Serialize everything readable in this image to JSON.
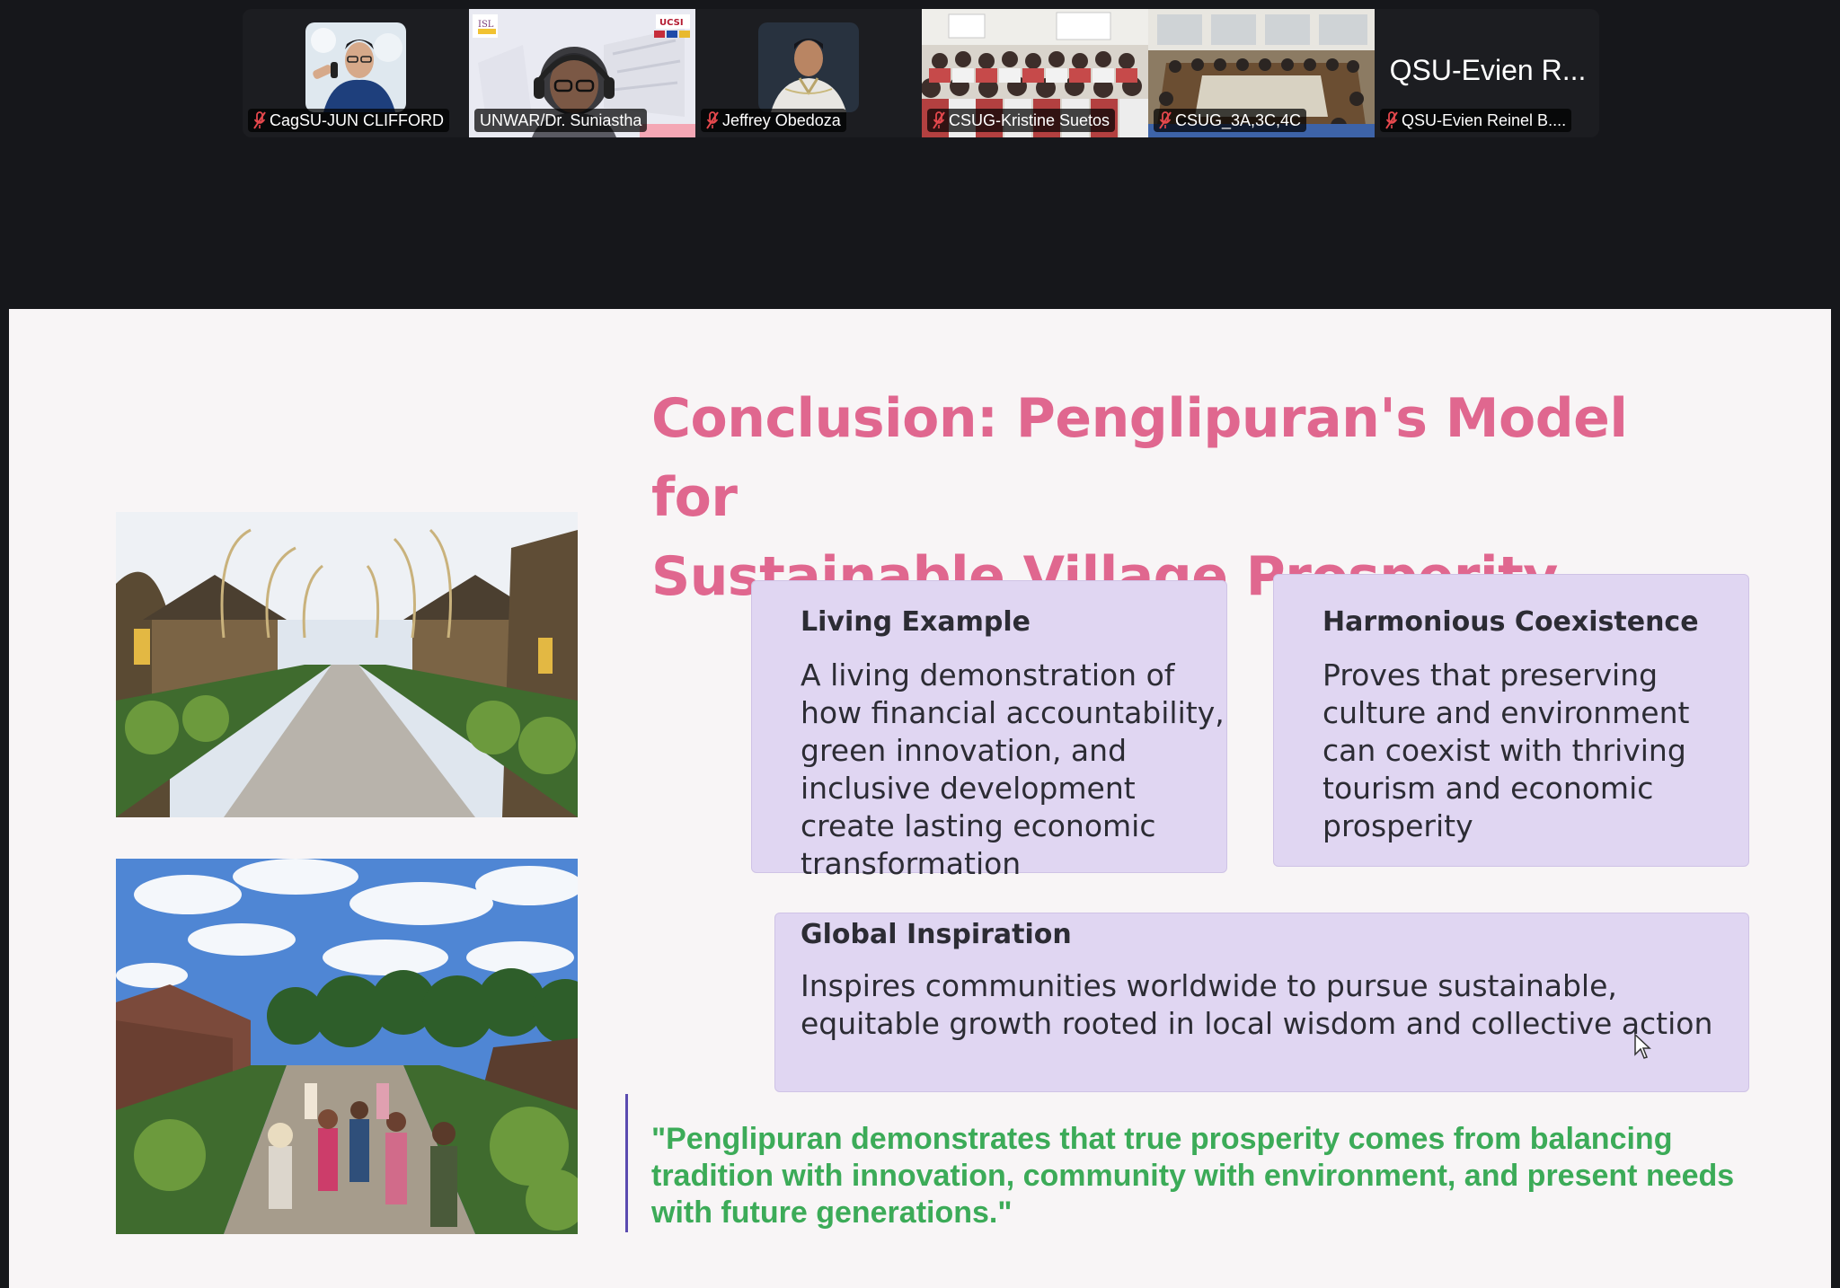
{
  "participants": [
    {
      "name": "CagSU-JUN CLIFFORD",
      "muted": true
    },
    {
      "name": "UNWAR/Dr. Suniastha",
      "muted": false,
      "active_speaker": true
    },
    {
      "name": "Jeffrey Obedoza",
      "muted": true
    },
    {
      "name": "CSUG-Kristine Suetos",
      "muted": true
    },
    {
      "name": "CSUG_3A,3C,4C",
      "muted": true
    },
    {
      "name": "QSU-Evien Reinel B....",
      "muted": true,
      "display_name": "QSU-Evien R..."
    }
  ],
  "slide": {
    "title_line1": "Conclusion: Penglipuran's Model for",
    "title_line2": "Sustainable Village Prosperity",
    "cards": [
      {
        "title": "Living Example",
        "lines": [
          "A living demonstration of",
          "how financial accountability,",
          "green innovation, and",
          "inclusive development",
          "create lasting economic",
          "transformation"
        ]
      },
      {
        "title": "Harmonious Coexistence",
        "lines": [
          "Proves that preserving",
          "culture and environment",
          "can coexist with thriving",
          "tourism and economic",
          "prosperity"
        ]
      },
      {
        "title": "Global Inspiration",
        "lines": [
          "Inspires communities worldwide to pursue sustainable,",
          "equitable growth rooted in local wisdom and collective action"
        ]
      }
    ],
    "quote_lines": [
      "\"Penglipuran demonstrates that true prosperity comes from balancing",
      "tradition with innovation, community with environment, and present needs",
      "with future generations.\""
    ]
  },
  "colors": {
    "title": "#e0678f",
    "card_bg": "#e0d6f2",
    "quote": "#3cab58",
    "active_speaker_border": "#4cd964"
  }
}
